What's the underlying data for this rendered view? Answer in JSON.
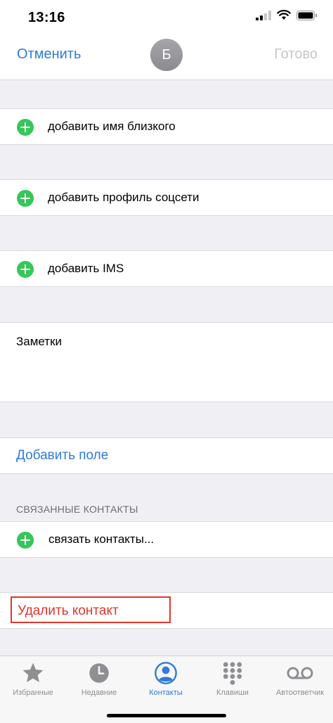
{
  "status": {
    "time": "13:16"
  },
  "nav": {
    "cancel": "Отменить",
    "avatar_letter": "Б",
    "done": "Готово"
  },
  "rows": {
    "relative": "добавить имя близкого",
    "social": "добавить профиль соцсети",
    "ims": "добавить IMS",
    "notes": "Заметки",
    "add_field": "Добавить поле",
    "linked_header": "СВЯЗАННЫЕ КОНТАКТЫ",
    "link_contacts": "связать контакты...",
    "delete": "Удалить контакт"
  },
  "tabs": [
    {
      "label": "Избранные",
      "icon": "star-icon"
    },
    {
      "label": "Недавние",
      "icon": "clock-icon"
    },
    {
      "label": "Контакты",
      "icon": "person-icon"
    },
    {
      "label": "Клавиши",
      "icon": "keypad-icon"
    },
    {
      "label": "Автоответчик",
      "icon": "voicemail-icon"
    }
  ],
  "active_tab": "Контакты",
  "colors": {
    "accent": "#2f7bd6",
    "plus": "#34c759",
    "destructive": "#e0352b",
    "highlight_box": "#e0352b"
  }
}
